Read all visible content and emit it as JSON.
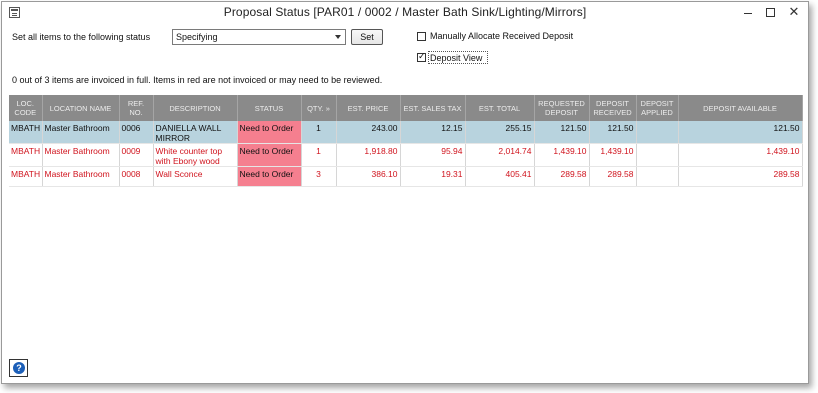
{
  "window": {
    "title": "Proposal Status [PAR01 / 0002 / Master Bath Sink/Lighting/Mirrors]",
    "minimize": "",
    "maximize": "",
    "close": "✕"
  },
  "controls": {
    "set_all_label": "Set all items to the following status",
    "status_value": "Specifying",
    "set_button": "Set",
    "manual_allocate_label": "Manually Allocate Received Deposit",
    "manual_allocate_checked": false,
    "deposit_view_label": "Deposit View",
    "deposit_view_checked": true
  },
  "info_text": "0 out of 3 items are invoiced in full.  Items in red are not invoiced or may need to be reviewed.",
  "table": {
    "columns": [
      "LOC. CODE",
      "LOCATION NAME",
      "REF. NO.",
      "DESCRIPTION",
      "STATUS",
      "QTY. »",
      "EST. PRICE",
      "EST. SALES TAX",
      "EST. TOTAL",
      "REQUESTED DEPOSIT",
      "DEPOSIT RECEIVED",
      "DEPOSIT APPLIED",
      "DEPOSIT AVAILABLE"
    ],
    "rows": [
      {
        "loc_code": "MBATH",
        "location": "Master Bathroom",
        "ref": "0006",
        "description": "DANIELLA WALL MIRROR",
        "status": "Need to Order",
        "qty": "1",
        "est_price": "243.00",
        "sales_tax": "12.15",
        "est_total": "255.15",
        "requested_deposit": "121.50",
        "deposit_received": "121.50",
        "deposit_applied": "",
        "deposit_available": "121.50",
        "style": "selected"
      },
      {
        "loc_code": "MBATH",
        "location": "Master Bathroom",
        "ref": "0009",
        "description": "White counter top with Ebony wood",
        "status": "Need to Order",
        "qty": "1",
        "est_price": "1,918.80",
        "sales_tax": "95.94",
        "est_total": "2,014.74",
        "requested_deposit": "1,439.10",
        "deposit_received": "1,439.10",
        "deposit_applied": "",
        "deposit_available": "1,439.10",
        "style": "red"
      },
      {
        "loc_code": "MBATH",
        "location": "Master Bathroom",
        "ref": "0008",
        "description": "Wall Sconce",
        "status": "Need to Order",
        "qty": "3",
        "est_price": "386.10",
        "sales_tax": "19.31",
        "est_total": "405.41",
        "requested_deposit": "289.58",
        "deposit_received": "289.58",
        "deposit_applied": "",
        "deposit_available": "289.58",
        "style": "red"
      }
    ]
  },
  "help_button": "?",
  "colors": {
    "header_bg": "#8a8a8a",
    "selected_row": "#b8d3de",
    "status_cell": "#f57f8f",
    "red_text": "#d0141e",
    "help_icon": "#1c5fb8"
  }
}
